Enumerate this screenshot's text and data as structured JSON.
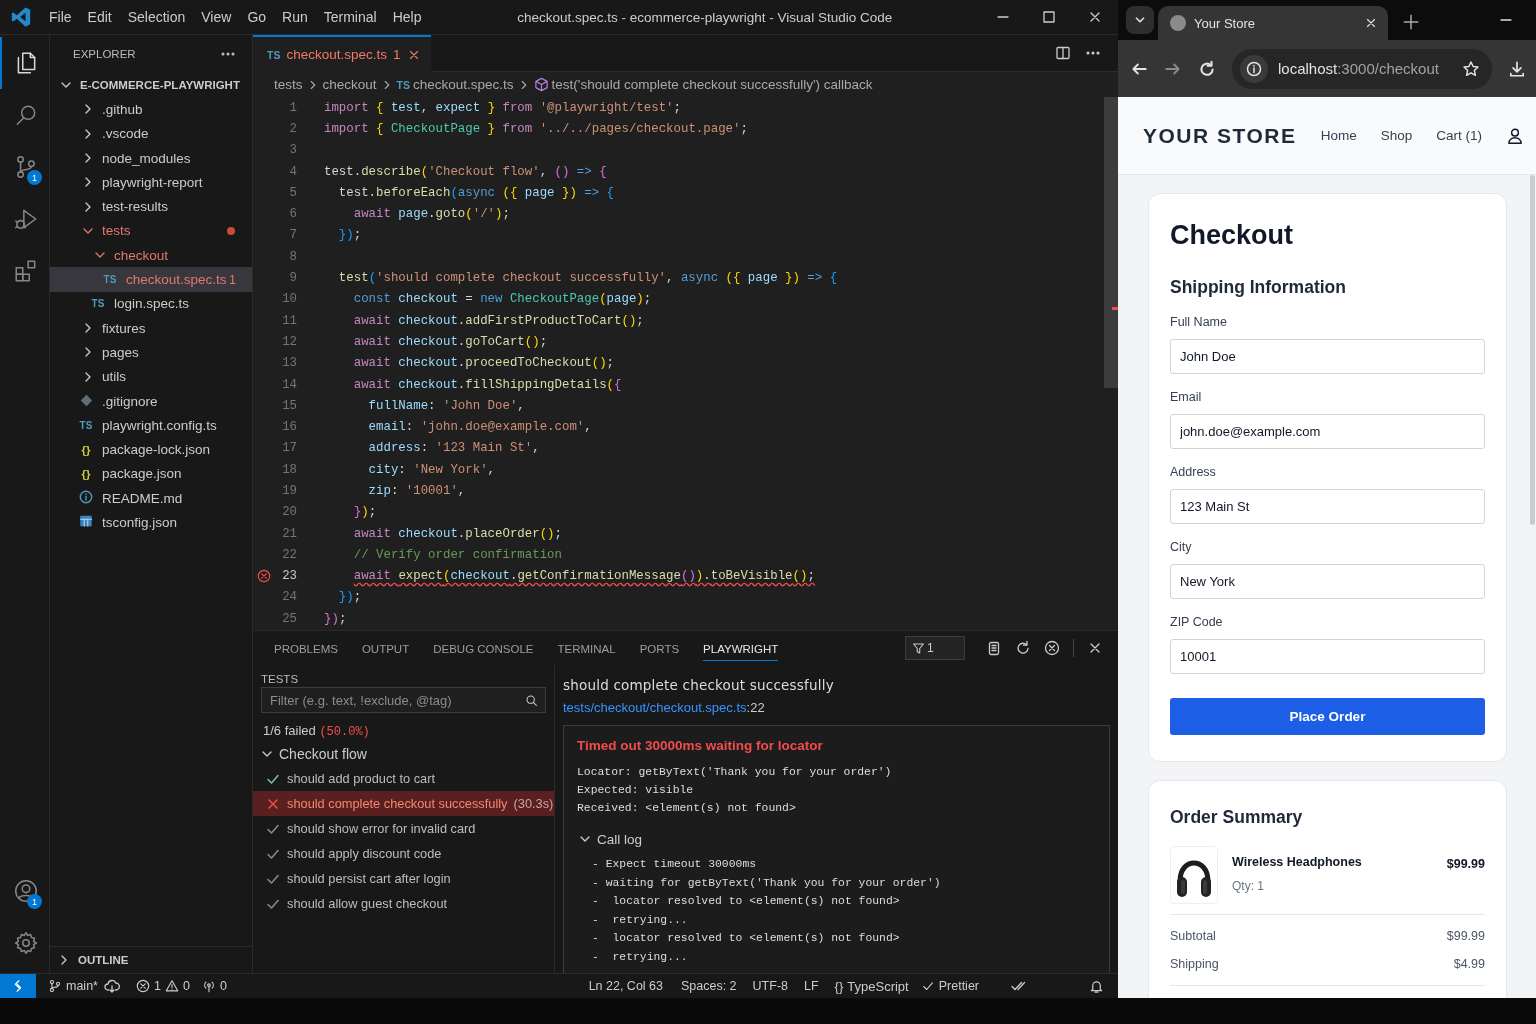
{
  "window": {
    "title": "checkout.spec.ts - ecommerce-playwright - Visual Studio Code"
  },
  "menu": [
    "File",
    "Edit",
    "Selection",
    "View",
    "Go",
    "Run",
    "Terminal",
    "Help"
  ],
  "activity_bar": {
    "items": [
      {
        "kind": "files",
        "selected": true
      },
      {
        "kind": "search",
        "selected": false
      },
      {
        "kind": "source-control",
        "selected": false,
        "badge": "1"
      },
      {
        "kind": "run-debug",
        "selected": false
      },
      {
        "kind": "extensions",
        "selected": false
      }
    ],
    "bottom": [
      {
        "kind": "account",
        "selected": false,
        "badge": "1"
      },
      {
        "kind": "settings",
        "selected": false
      }
    ]
  },
  "sidebar": {
    "title": "EXPLORER",
    "root": {
      "label": "E-COMMERCE-PLAYWRIGHT",
      "expanded": true,
      "children": [
        {
          "kind": "folder",
          "label": ".github",
          "expanded": false,
          "selected": false,
          "error": false
        },
        {
          "kind": "folder",
          "label": ".vscode",
          "expanded": false,
          "selected": false,
          "error": false
        },
        {
          "kind": "folder",
          "label": "node_modules",
          "expanded": false,
          "selected": false,
          "error": false
        },
        {
          "kind": "folder",
          "label": "playwright-report",
          "expanded": false,
          "selected": false,
          "error": false
        },
        {
          "kind": "folder",
          "label": "test-results",
          "expanded": false,
          "selected": false,
          "error": false
        },
        {
          "kind": "folder",
          "label": "tests",
          "expanded": true,
          "selected": false,
          "error": true,
          "children": [
            {
              "kind": "folder",
              "label": "checkout",
              "expanded": true,
              "selected": false,
              "error": true,
              "children": [
                {
                  "kind": "ts",
                  "icon_label": "TS",
                  "label": "checkout.spec.ts",
                  "selected": true,
                  "error": true,
                  "badge": "1"
                }
              ]
            },
            {
              "kind": "ts",
              "icon_label": "TS",
              "label": "login.spec.ts",
              "selected": false,
              "error": false
            }
          ]
        },
        {
          "kind": "folder",
          "label": "fixtures",
          "expanded": false,
          "selected": false,
          "error": false
        },
        {
          "kind": "folder",
          "label": "pages",
          "expanded": false,
          "selected": false,
          "error": false
        },
        {
          "kind": "folder",
          "label": "utils",
          "expanded": false,
          "selected": false,
          "error": false
        },
        {
          "kind": "git",
          "label": ".gitignore",
          "selected": false,
          "error": false
        },
        {
          "kind": "ts",
          "icon_label": "TS",
          "label": "playwright.config.ts",
          "selected": false,
          "error": false
        },
        {
          "kind": "json",
          "icon_label": "{}",
          "label": "package-lock.json",
          "selected": false,
          "error": false
        },
        {
          "kind": "json",
          "icon_label": "{}",
          "label": "package.json",
          "selected": false,
          "error": false
        },
        {
          "kind": "info",
          "label": "README.md",
          "selected": false,
          "error": false
        },
        {
          "kind": "tsconfig",
          "label": "tsconfig.json",
          "selected": false,
          "error": false
        }
      ]
    },
    "outline": {
      "label": "OUTLINE",
      "expanded": false
    }
  },
  "editor": {
    "tabs": [
      {
        "icon_label": "TS",
        "label": "checkout.spec.ts",
        "badge": "1",
        "error": true,
        "selected": true
      }
    ],
    "breadcrumbs": [
      {
        "kind": "folder",
        "label": "tests"
      },
      {
        "kind": "folder",
        "label": "checkout"
      },
      {
        "kind": "file",
        "icon_label": "TS",
        "label": "checkout.spec.ts"
      },
      {
        "kind": "symbol",
        "label": "test('should complete checkout successfully') callback"
      }
    ],
    "lines": [
      {
        "number": "1",
        "error": false,
        "tokens": [
          {
            "kind": "keyword",
            "text": "import "
          },
          {
            "kind": "brace1",
            "text": "{"
          },
          {
            "kind": "variable",
            "text": " test"
          },
          {
            "kind": "plain",
            "text": ", "
          },
          {
            "kind": "variable",
            "text": "expect "
          },
          {
            "kind": "brace1",
            "text": "}"
          },
          {
            "kind": "keyword",
            "text": " from "
          },
          {
            "kind": "string",
            "text": "'@playwright/test'"
          },
          {
            "kind": "plain",
            "text": ";"
          }
        ]
      },
      {
        "number": "2",
        "error": false,
        "tokens": [
          {
            "kind": "keyword",
            "text": "import "
          },
          {
            "kind": "brace1",
            "text": "{"
          },
          {
            "kind": "type",
            "text": " CheckoutPage "
          },
          {
            "kind": "brace1",
            "text": "}"
          },
          {
            "kind": "keyword",
            "text": " from "
          },
          {
            "kind": "string",
            "text": "'../../pages/checkout.page'"
          },
          {
            "kind": "plain",
            "text": ";"
          }
        ]
      },
      {
        "number": "3",
        "error": false
      },
      {
        "number": "4",
        "error": false,
        "tokens": [
          {
            "kind": "plain",
            "text": "test."
          },
          {
            "kind": "function",
            "text": "describe"
          },
          {
            "kind": "brace1",
            "text": "("
          },
          {
            "kind": "string",
            "text": "'Checkout flow'"
          },
          {
            "kind": "plain",
            "text": ", "
          },
          {
            "kind": "brace2",
            "text": "()"
          },
          {
            "kind": "storage",
            "text": " => "
          },
          {
            "kind": "brace2",
            "text": "{"
          }
        ]
      },
      {
        "number": "5",
        "error": false,
        "tokens": [
          {
            "kind": "plain",
            "text": "  test."
          },
          {
            "kind": "function",
            "text": "beforeEach"
          },
          {
            "kind": "brace3",
            "text": "("
          },
          {
            "kind": "storage",
            "text": "async "
          },
          {
            "kind": "brace1",
            "text": "({"
          },
          {
            "kind": "variable",
            "text": " page "
          },
          {
            "kind": "brace1",
            "text": "})"
          },
          {
            "kind": "storage",
            "text": " => "
          },
          {
            "kind": "brace3",
            "text": "{"
          }
        ]
      },
      {
        "number": "6",
        "error": false,
        "tokens": [
          {
            "kind": "keyword",
            "text": "    await "
          },
          {
            "kind": "variable",
            "text": "page"
          },
          {
            "kind": "plain",
            "text": "."
          },
          {
            "kind": "function",
            "text": "goto"
          },
          {
            "kind": "brace1",
            "text": "("
          },
          {
            "kind": "string",
            "text": "'/'"
          },
          {
            "kind": "brace1",
            "text": ")"
          },
          {
            "kind": "plain",
            "text": ";"
          }
        ]
      },
      {
        "number": "7",
        "error": false,
        "tokens": [
          {
            "kind": "brace3",
            "text": "  })"
          },
          {
            "kind": "plain",
            "text": ";"
          }
        ]
      },
      {
        "number": "8",
        "error": false
      },
      {
        "number": "9",
        "error": false,
        "tokens": [
          {
            "kind": "function",
            "text": "  test"
          },
          {
            "kind": "brace3",
            "text": "("
          },
          {
            "kind": "string",
            "text": "'should complete checkout successfully'"
          },
          {
            "kind": "plain",
            "text": ", "
          },
          {
            "kind": "storage",
            "text": "async "
          },
          {
            "kind": "brace1",
            "text": "({"
          },
          {
            "kind": "variable",
            "text": " page "
          },
          {
            "kind": "brace1",
            "text": "})"
          },
          {
            "kind": "storage",
            "text": " => "
          },
          {
            "kind": "brace3",
            "text": "{"
          }
        ]
      },
      {
        "number": "10",
        "error": false,
        "tokens": [
          {
            "kind": "storage",
            "text": "    const "
          },
          {
            "kind": "variable",
            "text": "checkout"
          },
          {
            "kind": "plain",
            "text": " = "
          },
          {
            "kind": "storage",
            "text": "new "
          },
          {
            "kind": "type",
            "text": "CheckoutPage"
          },
          {
            "kind": "brace1",
            "text": "("
          },
          {
            "kind": "variable",
            "text": "page"
          },
          {
            "kind": "brace1",
            "text": ")"
          },
          {
            "kind": "plain",
            "text": ";"
          }
        ]
      },
      {
        "number": "11",
        "error": false,
        "tokens": [
          {
            "kind": "keyword",
            "text": "    await "
          },
          {
            "kind": "variable",
            "text": "checkout"
          },
          {
            "kind": "plain",
            "text": "."
          },
          {
            "kind": "function",
            "text": "addFirstProductToCart"
          },
          {
            "kind": "brace1",
            "text": "()"
          },
          {
            "kind": "plain",
            "text": ";"
          }
        ]
      },
      {
        "number": "12",
        "error": false,
        "tokens": [
          {
            "kind": "keyword",
            "text": "    await "
          },
          {
            "kind": "variable",
            "text": "checkout"
          },
          {
            "kind": "plain",
            "text": "."
          },
          {
            "kind": "function",
            "text": "goToCart"
          },
          {
            "kind": "brace1",
            "text": "()"
          },
          {
            "kind": "plain",
            "text": ";"
          }
        ]
      },
      {
        "number": "13",
        "error": false,
        "tokens": [
          {
            "kind": "keyword",
            "text": "    await "
          },
          {
            "kind": "variable",
            "text": "checkout"
          },
          {
            "kind": "plain",
            "text": "."
          },
          {
            "kind": "function",
            "text": "proceedToCheckout"
          },
          {
            "kind": "brace1",
            "text": "()"
          },
          {
            "kind": "plain",
            "text": ";"
          }
        ]
      },
      {
        "number": "14",
        "error": false,
        "tokens": [
          {
            "kind": "keyword",
            "text": "    await "
          },
          {
            "kind": "variable",
            "text": "checkout"
          },
          {
            "kind": "plain",
            "text": "."
          },
          {
            "kind": "function",
            "text": "fillShippingDetails"
          },
          {
            "kind": "brace1",
            "text": "("
          },
          {
            "kind": "brace2",
            "text": "{"
          }
        ]
      },
      {
        "number": "15",
        "error": false,
        "tokens": [
          {
            "kind": "variable",
            "text": "      fullName"
          },
          {
            "kind": "plain",
            "text": ": "
          },
          {
            "kind": "string",
            "text": "'John Doe'"
          },
          {
            "kind": "plain",
            "text": ","
          }
        ]
      },
      {
        "number": "16",
        "error": false,
        "tokens": [
          {
            "kind": "variable",
            "text": "      email"
          },
          {
            "kind": "plain",
            "text": ": "
          },
          {
            "kind": "string",
            "text": "'john.doe@example.com'"
          },
          {
            "kind": "plain",
            "text": ","
          }
        ]
      },
      {
        "number": "17",
        "error": false,
        "tokens": [
          {
            "kind": "variable",
            "text": "      address"
          },
          {
            "kind": "plain",
            "text": ": "
          },
          {
            "kind": "string",
            "text": "'123 Main St'"
          },
          {
            "kind": "plain",
            "text": ","
          }
        ]
      },
      {
        "number": "18",
        "error": false,
        "tokens": [
          {
            "kind": "variable",
            "text": "      city"
          },
          {
            "kind": "plain",
            "text": ": "
          },
          {
            "kind": "string",
            "text": "'New York'"
          },
          {
            "kind": "plain",
            "text": ","
          }
        ]
      },
      {
        "number": "19",
        "error": false,
        "tokens": [
          {
            "kind": "variable",
            "text": "      zip"
          },
          {
            "kind": "plain",
            "text": ": "
          },
          {
            "kind": "string",
            "text": "'10001'"
          },
          {
            "kind": "plain",
            "text": ","
          }
        ]
      },
      {
        "number": "20",
        "error": false,
        "tokens": [
          {
            "kind": "brace2",
            "text": "    }"
          },
          {
            "kind": "brace1",
            "text": ")"
          },
          {
            "kind": "plain",
            "text": ";"
          }
        ]
      },
      {
        "number": "21",
        "error": false,
        "tokens": [
          {
            "kind": "keyword",
            "text": "    await "
          },
          {
            "kind": "variable",
            "text": "checkout"
          },
          {
            "kind": "plain",
            "text": "."
          },
          {
            "kind": "function",
            "text": "placeOrder"
          },
          {
            "kind": "brace1",
            "text": "()"
          },
          {
            "kind": "plain",
            "text": ";"
          }
        ]
      },
      {
        "number": "22",
        "error": false,
        "tokens": [
          {
            "kind": "comment",
            "text": "    // Verify order confirmation"
          }
        ]
      },
      {
        "number": "23",
        "error": true,
        "tokens": [
          {
            "kind": "keyword",
            "text": "    await "
          },
          {
            "kind": "function",
            "text": "expect"
          },
          {
            "kind": "brace1",
            "text": "("
          },
          {
            "kind": "variable",
            "text": "checkout"
          },
          {
            "kind": "plain",
            "text": "."
          },
          {
            "kind": "function",
            "text": "getConfirmationMessage"
          },
          {
            "kind": "brace2",
            "text": "()"
          },
          {
            "kind": "brace1",
            "text": ")"
          },
          {
            "kind": "plain",
            "text": "."
          },
          {
            "kind": "function",
            "text": "toBeVisible"
          },
          {
            "kind": "brace1",
            "text": "()"
          },
          {
            "kind": "plain",
            "text": ";"
          }
        ]
      },
      {
        "number": "24",
        "error": false,
        "tokens": [
          {
            "kind": "brace3",
            "text": "  })"
          },
          {
            "kind": "plain",
            "text": ";"
          }
        ]
      },
      {
        "number": "25",
        "error": false,
        "tokens": [
          {
            "kind": "brace2",
            "text": "})"
          },
          {
            "kind": "plain",
            "text": ";"
          }
        ]
      }
    ]
  },
  "panel": {
    "tabs": [
      {
        "label": "PROBLEMS",
        "selected": false
      },
      {
        "label": "OUTPUT",
        "selected": false
      },
      {
        "label": "DEBUG CONSOLE",
        "selected": false
      },
      {
        "label": "TERMINAL",
        "selected": false
      },
      {
        "label": "PORTS",
        "selected": false
      },
      {
        "label": "PLAYWRIGHT",
        "selected": true
      }
    ],
    "filter_count": "1",
    "tests": {
      "header": "TESTS",
      "filter": {
        "placeholder": "Filter (e.g. text, !exclude, @tag)"
      },
      "summary": "1/6 failed",
      "summary_percent": "(50.0%)",
      "groups": [
        {
          "label": "Checkout flow",
          "expanded": true,
          "tests": [
            {
              "name": "should add product to cart",
              "kind": "passed",
              "selected": false
            },
            {
              "name": "should complete checkout successfully",
              "kind": "failed",
              "duration": "(30.3s)",
              "selected": true
            },
            {
              "name": "should show error for invalid card",
              "kind": "stale",
              "selected": false
            },
            {
              "name": "should apply discount code",
              "kind": "stale",
              "selected": false
            },
            {
              "name": "should persist cart after login",
              "kind": "stale",
              "selected": false
            },
            {
              "name": "should allow guest checkout",
              "kind": "stale",
              "selected": false
            }
          ]
        }
      ]
    },
    "details": {
      "title": "should complete checkout successfully",
      "file": "tests/checkout/checkout.spec.ts",
      "line": ":22",
      "error": {
        "heading": "Timed out 30000ms waiting for locator",
        "lines": [
          "Locator: getByText('Thank you for your order')",
          "Expected: visible",
          "Received: <element(s) not found>"
        ]
      },
      "call_log": {
        "label": "Call log",
        "expanded": true,
        "lines": [
          "- Expect timeout 30000ms",
          "- waiting for getByText('Thank you for your order')",
          "-  locator resolved to <element(s) not found>",
          "-  retrying...",
          "-  locator resolved to <element(s) not found>",
          "-  retrying..."
        ]
      }
    }
  },
  "status_bar": {
    "branch": "main*",
    "errors": "1",
    "warnings": "0",
    "ports": "0",
    "position": "Ln 22, Col 63",
    "indent": "Spaces: 2",
    "encoding": "UTF-8",
    "eol": "LF",
    "language_icon": "{}",
    "language": "TypeScript",
    "formatter": "Prettier"
  },
  "browser": {
    "tab": {
      "title": "Your Store"
    },
    "url": {
      "host": "localhost",
      "path": ":3000/checkout"
    },
    "store": {
      "brand": "YOUR STORE",
      "nav": [
        "Home",
        "Shop",
        "Cart (1)"
      ],
      "checkout": {
        "title": "Checkout",
        "section": "Shipping Information",
        "fields": [
          {
            "label": "Full Name",
            "value": "John Doe"
          },
          {
            "label": "Email",
            "value": "john.doe@example.com"
          },
          {
            "label": "Address",
            "value": "123 Main St"
          },
          {
            "label": "City",
            "value": "New York"
          },
          {
            "label": "ZIP Code",
            "value": "10001"
          }
        ],
        "button": "Place Order"
      },
      "summary": {
        "title": "Order Summary",
        "items": [
          {
            "name": "Wireless Headphones",
            "qty": "Qty: 1",
            "price": "$99.99"
          }
        ],
        "totals": [
          {
            "label": "Subtotal",
            "value": "$99.99"
          },
          {
            "label": "Shipping",
            "value": "$4.99"
          }
        ]
      }
    }
  }
}
